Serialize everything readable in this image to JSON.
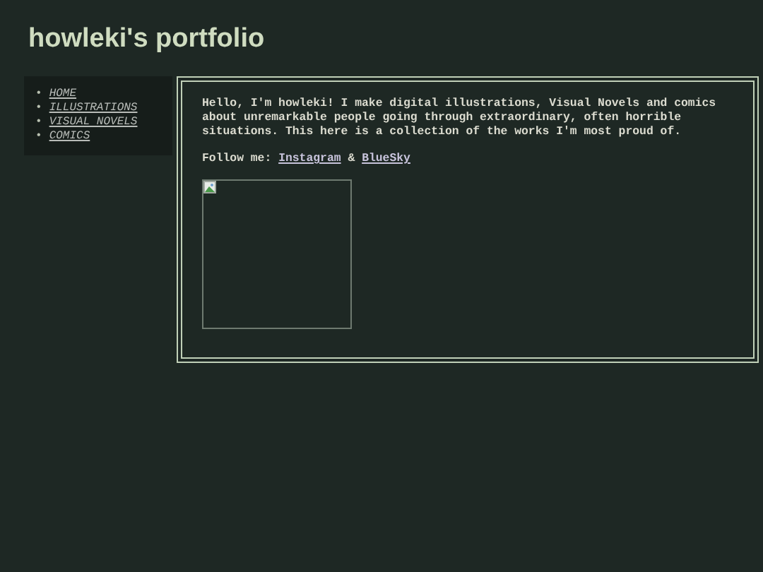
{
  "title": "howleki's portfolio",
  "nav": [
    {
      "bullet": "•",
      "label": "HOME"
    },
    {
      "bullet": "•",
      "label": "ILLUSTRATIONS"
    },
    {
      "bullet": "•",
      "label": "VISUAL NOVELS"
    },
    {
      "bullet": "•",
      "label": "COMICS"
    }
  ],
  "intro": "Hello, I'm howleki! I make digital illustrations, Visual Novels and comics about unremarkable people going through extraordinary, often horrible situations. This here is a collection of the works I'm most proud of.",
  "follow": {
    "label": "Follow me:",
    "links": [
      "Instagram",
      "BlueSky"
    ],
    "separator": "&"
  },
  "image": {
    "kind": "broken"
  }
}
